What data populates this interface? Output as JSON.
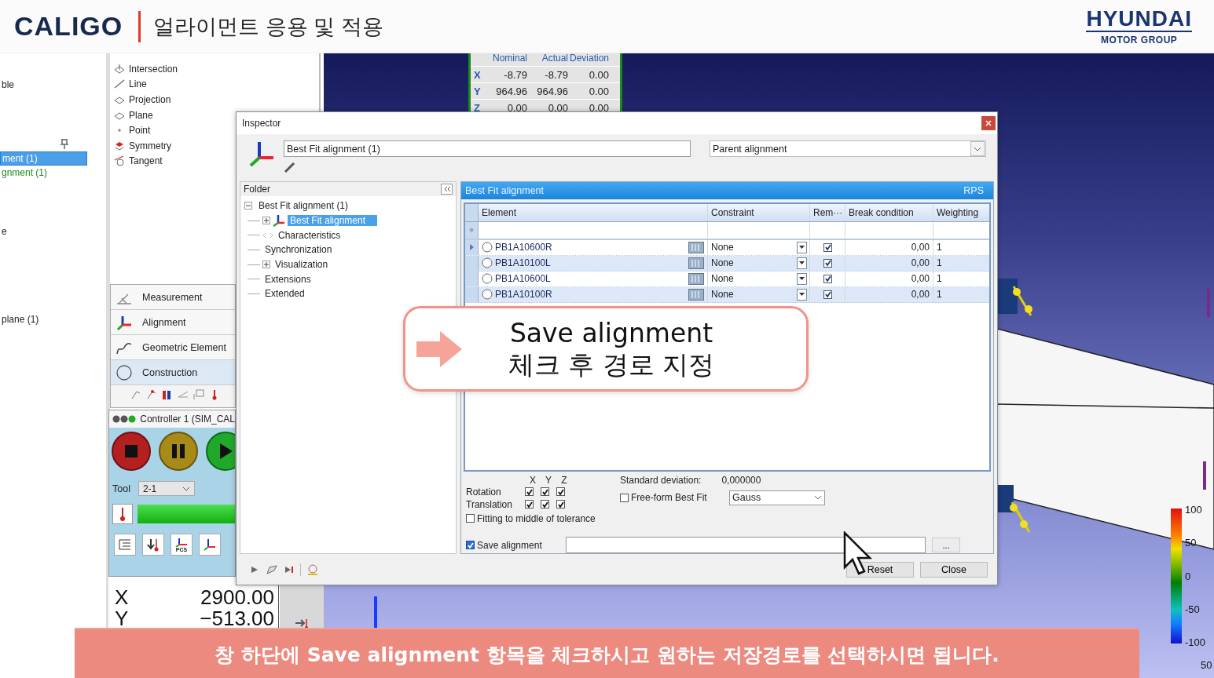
{
  "header": {
    "logo": "CALIGO",
    "title": "얼라이먼트 응용 및 적용",
    "brand": "HYUNDAI",
    "brand_sub": "MOTOR GROUP"
  },
  "left_tree": [
    {
      "label": "ble",
      "selected": false,
      "kind": "normal"
    },
    {
      "label": "ment (1)",
      "selected": true,
      "kind": "normal"
    },
    {
      "label": "gnment (1)",
      "selected": false,
      "kind": "green"
    },
    {
      "label": "e",
      "selected": false,
      "kind": "normal"
    },
    {
      "label": "plane (1)",
      "selected": false,
      "kind": "normal"
    }
  ],
  "element_list": [
    {
      "label": "Intersection"
    },
    {
      "label": "Line"
    },
    {
      "label": "Projection"
    },
    {
      "label": "Plane"
    },
    {
      "label": "Point"
    },
    {
      "label": "Symmetry"
    },
    {
      "label": "Tangent"
    }
  ],
  "tool_groups": [
    {
      "label": "Measurement",
      "selected": false
    },
    {
      "label": "Alignment",
      "selected": false
    },
    {
      "label": "Geometric Element",
      "selected": false
    },
    {
      "label": "Construction",
      "selected": true
    }
  ],
  "controller": {
    "title": "Controller 1 (SIM_CAL",
    "tool_label": "Tool",
    "tool_value": "2-1",
    "pcs_label": "PCS"
  },
  "coordinates": [
    {
      "axis": "X",
      "value": "2900.00"
    },
    {
      "axis": "Y",
      "value": "−513.00"
    }
  ],
  "readout": {
    "columns": [
      "Nominal",
      "Actual",
      "Deviation"
    ],
    "rows": [
      {
        "axis": "X",
        "nominal": "-8.79",
        "actual": "-8.79",
        "deviation": "0.00"
      },
      {
        "axis": "Y",
        "nominal": "964.96",
        "actual": "964.96",
        "deviation": "0.00"
      },
      {
        "axis": "Z",
        "nominal": "0.00",
        "actual": "0.00",
        "deviation": "0.00"
      }
    ]
  },
  "inspector": {
    "title": "Inspector",
    "name_value": "Best Fit alignment (1)",
    "parent": "Parent alignment",
    "folder_title": "Folder",
    "tree": [
      {
        "label": "Best Fit alignment (1)",
        "selected": false,
        "expanded": true,
        "children": [
          {
            "label": "Best Fit alignment",
            "selected": true,
            "expanded": false
          },
          {
            "label": "Characteristics",
            "selected": false
          },
          {
            "label": "Synchronization",
            "selected": false
          },
          {
            "label": "Visualization",
            "selected": false,
            "expanded": false
          },
          {
            "label": "Extensions",
            "selected": false
          },
          {
            "label": "Extended",
            "selected": false
          }
        ]
      }
    ],
    "panel_title": "Best Fit alignment",
    "panel_tag": "RPS",
    "columns": [
      "Element",
      "Constraint",
      "Rem···",
      "Break condition",
      "Weighting"
    ],
    "rows": [
      {
        "element": "PB1A10600R",
        "constraint": "None",
        "checked": true,
        "break": "0,00",
        "weighting": "1",
        "selected": true
      },
      {
        "element": "PB1A10100L",
        "constraint": "None",
        "checked": true,
        "break": "0,00",
        "weighting": "1",
        "selected": false
      },
      {
        "element": "PB1A10600L",
        "constraint": "None",
        "checked": true,
        "break": "0,00",
        "weighting": "1",
        "selected": false
      },
      {
        "element": "PB1A10100R",
        "constraint": "None",
        "checked": true,
        "break": "0,00",
        "weighting": "1",
        "selected": false
      }
    ],
    "axes": [
      "X",
      "Y",
      "Z"
    ],
    "rotation": {
      "label": "Rotation",
      "checks": [
        true,
        true,
        true
      ]
    },
    "translation": {
      "label": "Translation",
      "checks": [
        true,
        true,
        true
      ]
    },
    "std_dev_label": "Standard deviation:",
    "std_dev_value": "0,000000",
    "freeform": {
      "label": "Free-form Best Fit",
      "checked": false
    },
    "method": "Gauss",
    "fit_middle": {
      "label": "Fitting to middle of tolerance",
      "checked": false
    },
    "save": {
      "label": "Save alignment",
      "checked": true
    },
    "browse": "...",
    "buttons": [
      "Reset",
      "Close"
    ]
  },
  "callout": {
    "line1": "Save alignment",
    "line2": "체크 후 경로 지정"
  },
  "legend": {
    "labels": [
      "100",
      "50",
      "0",
      "-50",
      "-100"
    ],
    "scale": "50"
  },
  "subtitle": "창 하단에 Save alignment 항목을 체크하시고 원하는 저장경로를 선택하시면 됩니다."
}
